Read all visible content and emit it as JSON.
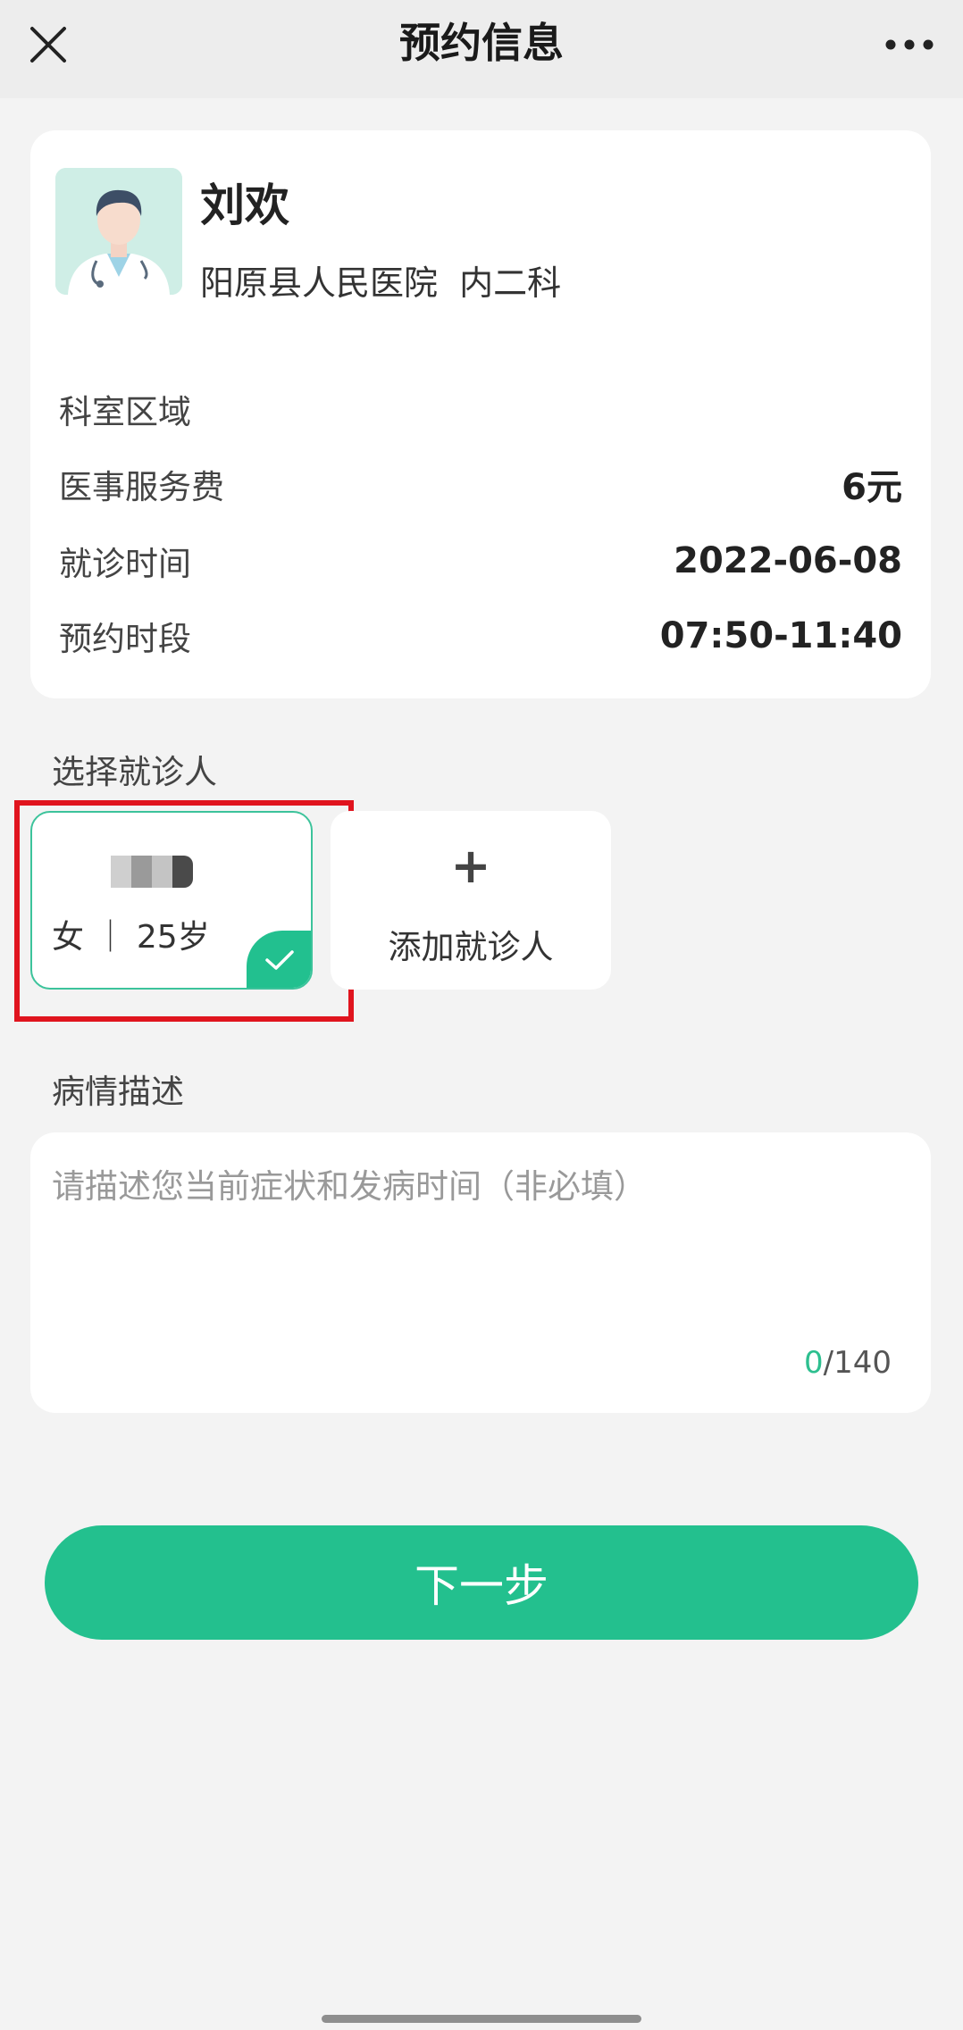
{
  "header": {
    "title": "预约信息"
  },
  "doctor": {
    "name": "刘欢",
    "hospital_line": "阳原县人民医院  内二科"
  },
  "info": {
    "rows": [
      {
        "label": "科室区域",
        "value": ""
      },
      {
        "label": "医事服务费",
        "value": "6元"
      },
      {
        "label": "就诊时间",
        "value": "2022-06-08"
      },
      {
        "label": "预约时段",
        "value": "07:50-11:40"
      }
    ]
  },
  "patient_section": {
    "title": "选择就诊人",
    "selected_patient": {
      "gender_age": "女 ｜ 25岁"
    },
    "add_icon": "+",
    "add_label": "添加就诊人"
  },
  "description": {
    "title": "病情描述",
    "placeholder": "请描述您当前症状和发病时间（非必填）",
    "count_current": "0",
    "count_max": "/140"
  },
  "next_button": "下一步",
  "colors": {
    "accent": "#23c08e",
    "highlight": "#e0141e"
  }
}
